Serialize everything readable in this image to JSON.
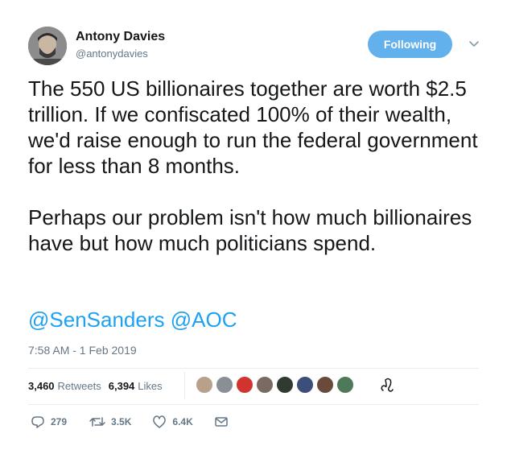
{
  "author": {
    "name": "Antony Davies",
    "handle": "@antonydavies"
  },
  "follow_button": {
    "label": "Following"
  },
  "tweet": {
    "paragraph1": "The 550 US billionaires together are worth $2.5 trillion. If we confiscated 100% of their wealth, we'd raise enough to run the federal government for less than 8 months.",
    "paragraph2": "Perhaps our problem isn't how much billionaires have but how much politicians spend.",
    "mention1": "@SenSanders",
    "mention2": "@AOC",
    "timestamp": "7:58 AM - 1 Feb 2019"
  },
  "stats": {
    "retweets_count": "3,460",
    "retweets_label": "Retweets",
    "likes_count": "6,394",
    "likes_label": "Likes"
  },
  "likers": [
    {
      "icon": "liker-avatar-1",
      "color": "#b9a08a"
    },
    {
      "icon": "liker-avatar-2",
      "color": "#8a8f96"
    },
    {
      "icon": "liker-avatar-3",
      "color": "#d0342c"
    },
    {
      "icon": "liker-avatar-4",
      "color": "#7a6a62"
    },
    {
      "icon": "liker-avatar-5",
      "color": "#2f3a30"
    },
    {
      "icon": "liker-avatar-6",
      "color": "#3b4f7a"
    },
    {
      "icon": "liker-avatar-7",
      "color": "#6a4a3a"
    },
    {
      "icon": "liker-avatar-8",
      "color": "#4f7a5a"
    }
  ],
  "actions": {
    "replies": "279",
    "retweets": "3.5K",
    "likes": "6.4K"
  },
  "colors": {
    "accent": "#1da1f2",
    "follow_button": "#62b0ec",
    "muted": "#657786"
  }
}
